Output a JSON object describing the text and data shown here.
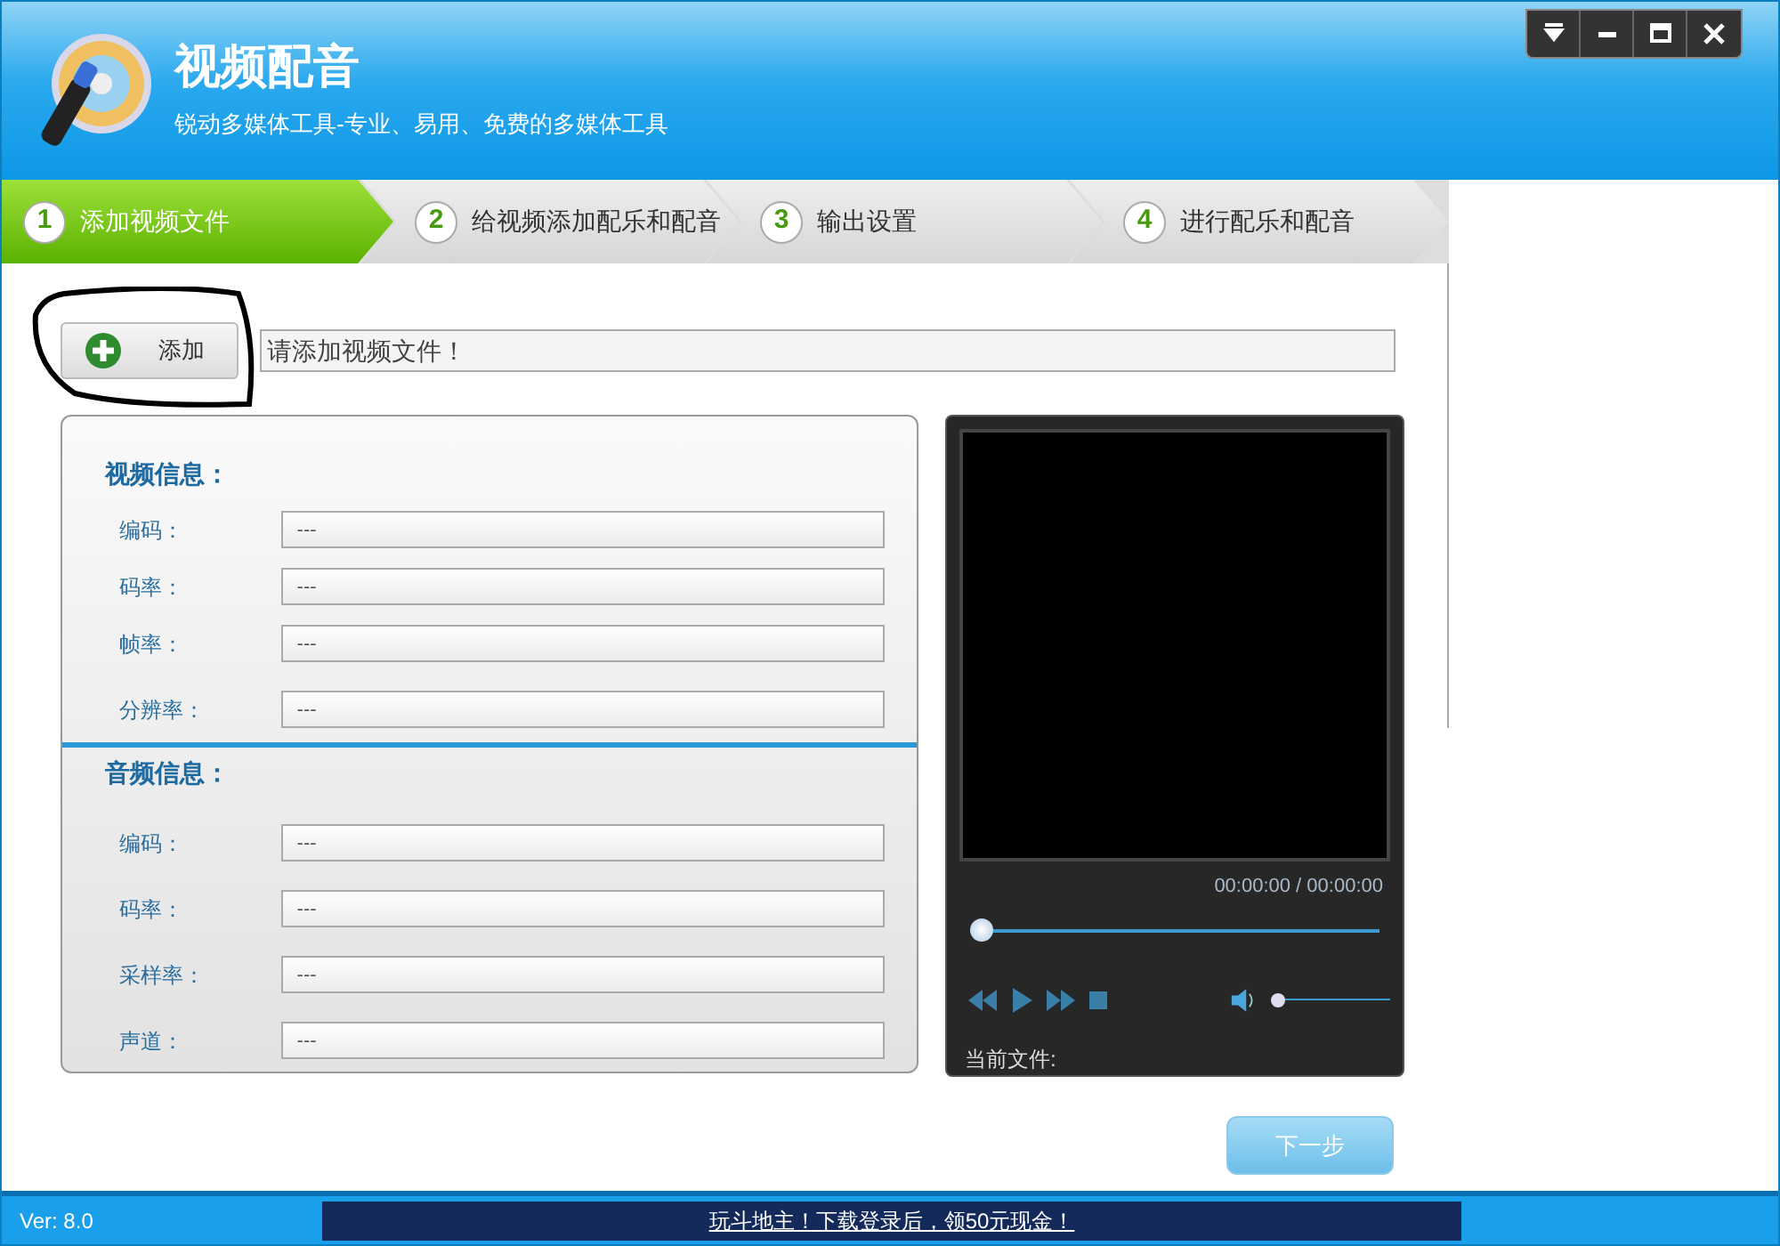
{
  "window": {
    "title": "视频配音",
    "subtitle": "锐动多媒体工具-专业、易用、免费的多媒体工具"
  },
  "window_buttons": [
    {
      "kind": "dropdown"
    },
    {
      "kind": "minimize"
    },
    {
      "kind": "maximize"
    },
    {
      "kind": "close"
    }
  ],
  "steps": [
    {
      "number": "1",
      "label": "添加视频文件",
      "selected": true
    },
    {
      "number": "2",
      "label": "给视频添加配乐和配音",
      "selected": false
    },
    {
      "number": "3",
      "label": "输出设置",
      "selected": false
    },
    {
      "number": "4",
      "label": "进行配乐和配音",
      "selected": false
    }
  ],
  "add_button": {
    "label": "添加"
  },
  "file_field": {
    "placeholder": "请添加视频文件！"
  },
  "video_info": {
    "title": "视频信息：",
    "fields": [
      {
        "label": "编码：",
        "value": "---"
      },
      {
        "label": "码率：",
        "value": "---"
      },
      {
        "label": "帧率：",
        "value": "---"
      },
      {
        "label": "分辨率：",
        "value": "---"
      }
    ]
  },
  "audio_info": {
    "title": "音频信息：",
    "fields": [
      {
        "label": "编码：",
        "value": "---"
      },
      {
        "label": "码率：",
        "value": "---"
      },
      {
        "label": "采样率：",
        "value": "---"
      },
      {
        "label": "声道：",
        "value": "---"
      }
    ]
  },
  "player": {
    "time": "00:00:00 / 00:00:00",
    "progress": {
      "level": 0
    },
    "volume": {
      "level": 0
    },
    "current_file_label": "当前文件:"
  },
  "next_button": {
    "label": "下一步"
  },
  "status_bar": {
    "version": "Ver: 8.0",
    "ad": "玩斗地主！下载登录后，领50元现金！"
  }
}
